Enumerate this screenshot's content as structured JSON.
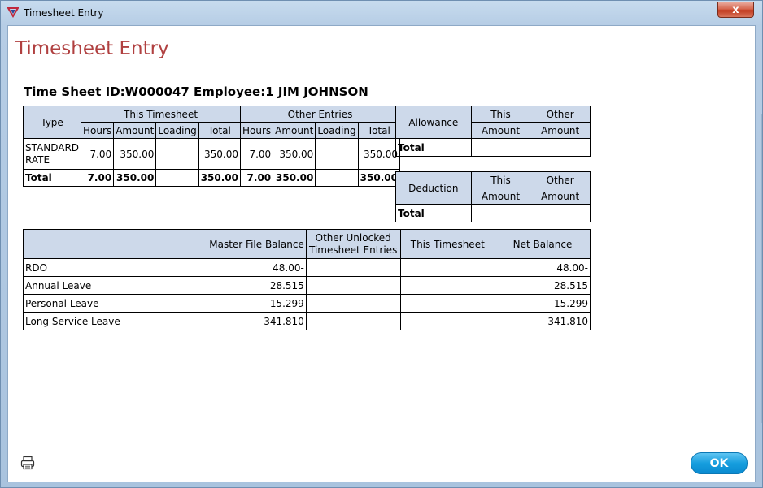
{
  "window": {
    "title": "Timesheet Entry",
    "close_label": "x"
  },
  "page": {
    "heading": "Timesheet Entry",
    "subheading": "Time Sheet ID:W000047 Employee:1 JIM JOHNSON"
  },
  "main_table": {
    "type_header": "Type",
    "group_this": "This Timesheet",
    "group_other": "Other Entries",
    "cols": [
      "Hours",
      "Amount",
      "Loading",
      "Total",
      "Hours",
      "Amount",
      "Loading",
      "Total"
    ],
    "row": {
      "type": "STANDARD RATE",
      "cells": [
        "7.00",
        "350.00",
        "",
        "350.00",
        "7.00",
        "350.00",
        "",
        "350.00"
      ]
    },
    "total": {
      "label": "Total",
      "cells": [
        "7.00",
        "350.00",
        "",
        "350.00",
        "7.00",
        "350.00",
        "",
        "350.00"
      ]
    }
  },
  "allowance": {
    "header": "Allowance",
    "this_top": "This",
    "this_bottom": "Amount",
    "other_top": "Other",
    "other_bottom": "Amount",
    "total_label": "Total"
  },
  "deduction": {
    "header": "Deduction",
    "this_top": "This",
    "this_bottom": "Amount",
    "other_top": "Other",
    "other_bottom": "Amount",
    "total_label": "Total"
  },
  "leave": {
    "headers": [
      "",
      "Master File Balance",
      "Other Unlocked Timesheet Entries",
      "This Timesheet",
      "Net Balance"
    ],
    "rows": [
      [
        "RDO",
        "48.00-",
        "",
        "",
        "48.00-"
      ],
      [
        "Annual Leave",
        "28.515",
        "",
        "",
        "28.515"
      ],
      [
        "Personal Leave",
        "15.299",
        "",
        "",
        "15.299"
      ],
      [
        "Long Service Leave",
        "341.810",
        "",
        "",
        "341.810"
      ]
    ]
  },
  "footer": {
    "ok_label": "OK",
    "print_icon": "printer-icon"
  }
}
